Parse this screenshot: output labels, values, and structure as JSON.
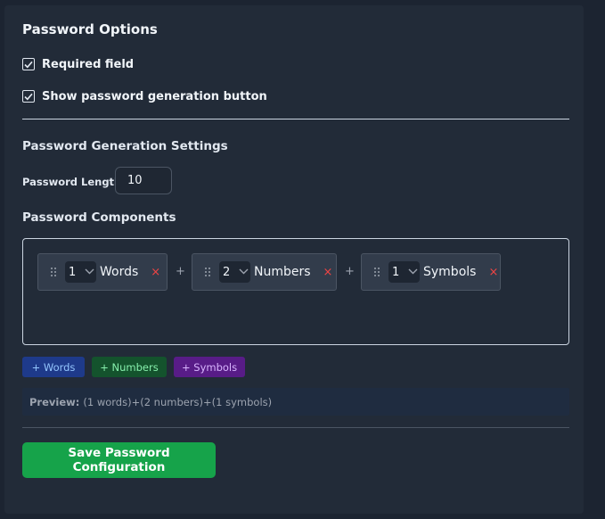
{
  "options": {
    "title": "Password Options",
    "required_label": "Required field",
    "required_checked": true,
    "show_gen_label": "Show password generation button",
    "show_gen_checked": true
  },
  "generation": {
    "title": "Password Generation Settings",
    "length_label": "Password Length",
    "length_value": "10",
    "components_title": "Password Components",
    "components": [
      {
        "count": "1",
        "label": "Words"
      },
      {
        "count": "2",
        "label": "Numbers"
      },
      {
        "count": "1",
        "label": "Symbols"
      }
    ],
    "plus": "+",
    "remove": "×"
  },
  "add_buttons": {
    "words": "+ Words",
    "numbers": "+ Numbers",
    "symbols": "+ Symbols"
  },
  "preview": {
    "label": "Preview:",
    "value": "(1 words)+(2 numbers)+(1 symbols)"
  },
  "save_label": "Save Password Configuration",
  "colors": {
    "accent_green": "#16a34a",
    "remove_red": "#ef4444",
    "words_bg": "#1e3a8a",
    "numbers_bg": "#14532d",
    "symbols_bg": "#581c87"
  }
}
